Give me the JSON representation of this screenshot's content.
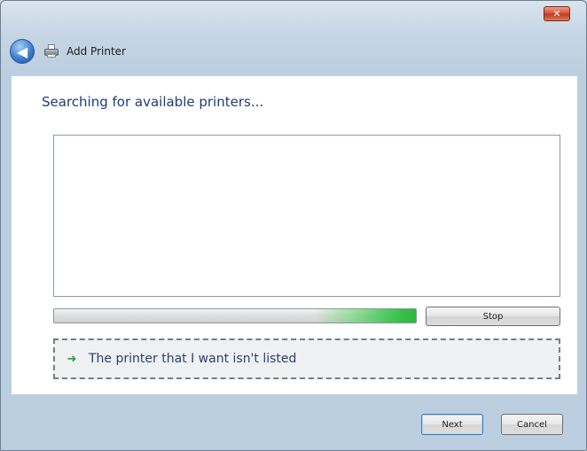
{
  "window": {
    "close_glyph": "✕"
  },
  "nav": {
    "back_glyph": "◀",
    "title": "Add Printer"
  },
  "main": {
    "heading": "Searching for available printers...",
    "progress": {
      "glow_start_fraction": 0.72,
      "glow_end_fraction": 1.0
    },
    "stop_label": "Stop",
    "not_listed_arrow": "➜",
    "not_listed_label": "The printer that I want isn't listed"
  },
  "footer": {
    "next_label": "Next",
    "cancel_label": "Cancel"
  },
  "icons": {
    "close": "close-icon",
    "back": "back-arrow-icon",
    "printer": "printer-icon",
    "link_arrow": "green-arrow-icon"
  },
  "colors": {
    "heading": "#1f3a78",
    "link_text": "#2b3f6b",
    "progress_glow": "#36c14a",
    "close_button": "#c23c20"
  }
}
